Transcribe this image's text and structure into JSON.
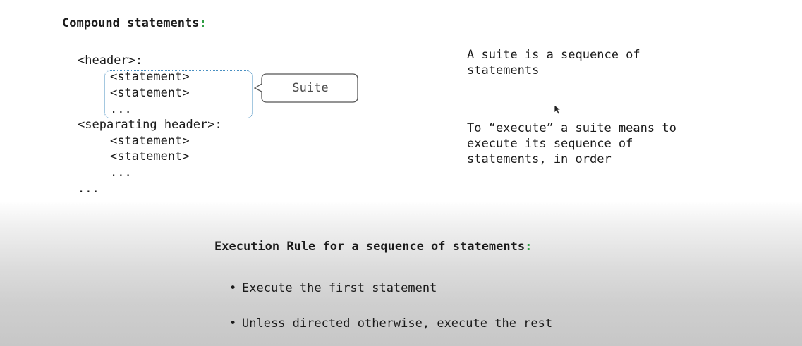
{
  "heading": {
    "text": "Compound statements",
    "colon": ":"
  },
  "code": {
    "header": "<header>:",
    "stmt1": "<statement>",
    "stmt2": "<statement>",
    "ellipsis1": "...",
    "sep_header": "<separating header>:",
    "stmt3": "<statement>",
    "stmt4": "<statement>",
    "ellipsis2": "...",
    "ellipsis3": "..."
  },
  "callout": {
    "label": "Suite"
  },
  "notes": {
    "suite_def": "A suite is a sequence of\nstatements",
    "execute_def": "To “execute” a suite means to\nexecute its sequence of\nstatements, in order"
  },
  "rule": {
    "title": "Execution Rule for a sequence of statements",
    "colon": ":",
    "bullets": [
      "Execute the first statement",
      "Unless directed otherwise, execute the rest"
    ],
    "bullet_glyph": "•"
  },
  "colors": {
    "accent_colon": "#2f9e44",
    "suite_border": "#4a90c2"
  }
}
